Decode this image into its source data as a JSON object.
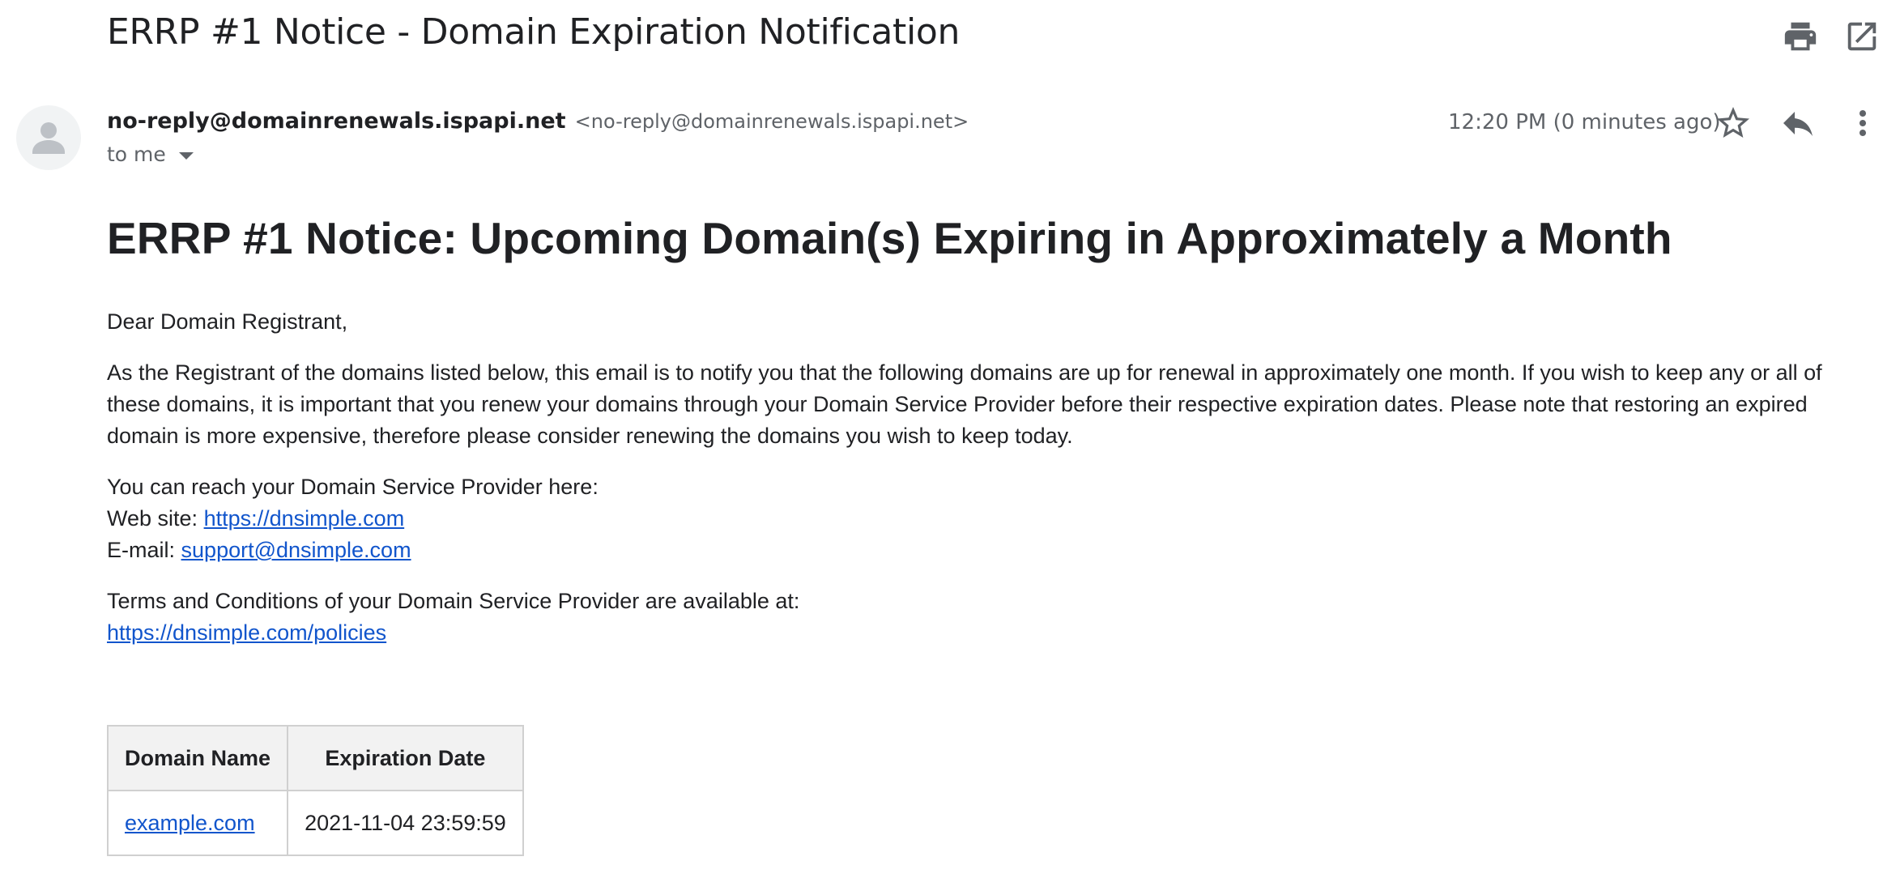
{
  "email": {
    "subject": "ERRP #1 Notice - Domain Expiration Notification",
    "sender_name": "no-reply@domainrenewals.ispapi.net",
    "sender_email": "<no-reply@domainrenewals.ispapi.net>",
    "recipient_label": "to me",
    "timestamp": "12:20 PM (0 minutes ago)"
  },
  "icons": {
    "print": "print-icon",
    "open_new_window": "open-in-new-window-icon",
    "star": "star-icon",
    "reply": "reply-icon",
    "more": "more-vertical-icon",
    "avatar": "default-avatar-icon"
  },
  "message": {
    "headline": "ERRP #1 Notice: Upcoming Domain(s) Expiring in Approximately a Month",
    "greeting": "Dear Domain Registrant,",
    "notice": "As the Registrant of the domains listed below, this email is to notify you that the following domains are up for renewal in approximately one month. If you wish to keep any or all of these domains, it is important that you renew your domains through your Domain Service Provider before their respective expiration dates. Please note that restoring an expired domain is more expensive, therefore please consider renewing the domains you wish to keep today.",
    "reach_intro": "You can reach your Domain Service Provider here:",
    "website_label": "Web site:",
    "website_url": "https://dnsimple.com",
    "email_label": "E-mail:",
    "email_address": "support@dnsimple.com",
    "terms_intro": "Terms and Conditions of your Domain Service Provider are available at:",
    "terms_url": "https://dnsimple.com/policies"
  },
  "table": {
    "headers": [
      "Domain Name",
      "Expiration Date"
    ],
    "rows": [
      {
        "domain": "example.com",
        "expiration": "2021-11-04 23:59:59"
      }
    ]
  },
  "colors": {
    "link": "#1155cc",
    "text": "#202124",
    "muted": "#5f6368",
    "icon": "#5f6368",
    "table_header_bg": "#f2f2f2",
    "table_border": "#d0d0d0"
  }
}
